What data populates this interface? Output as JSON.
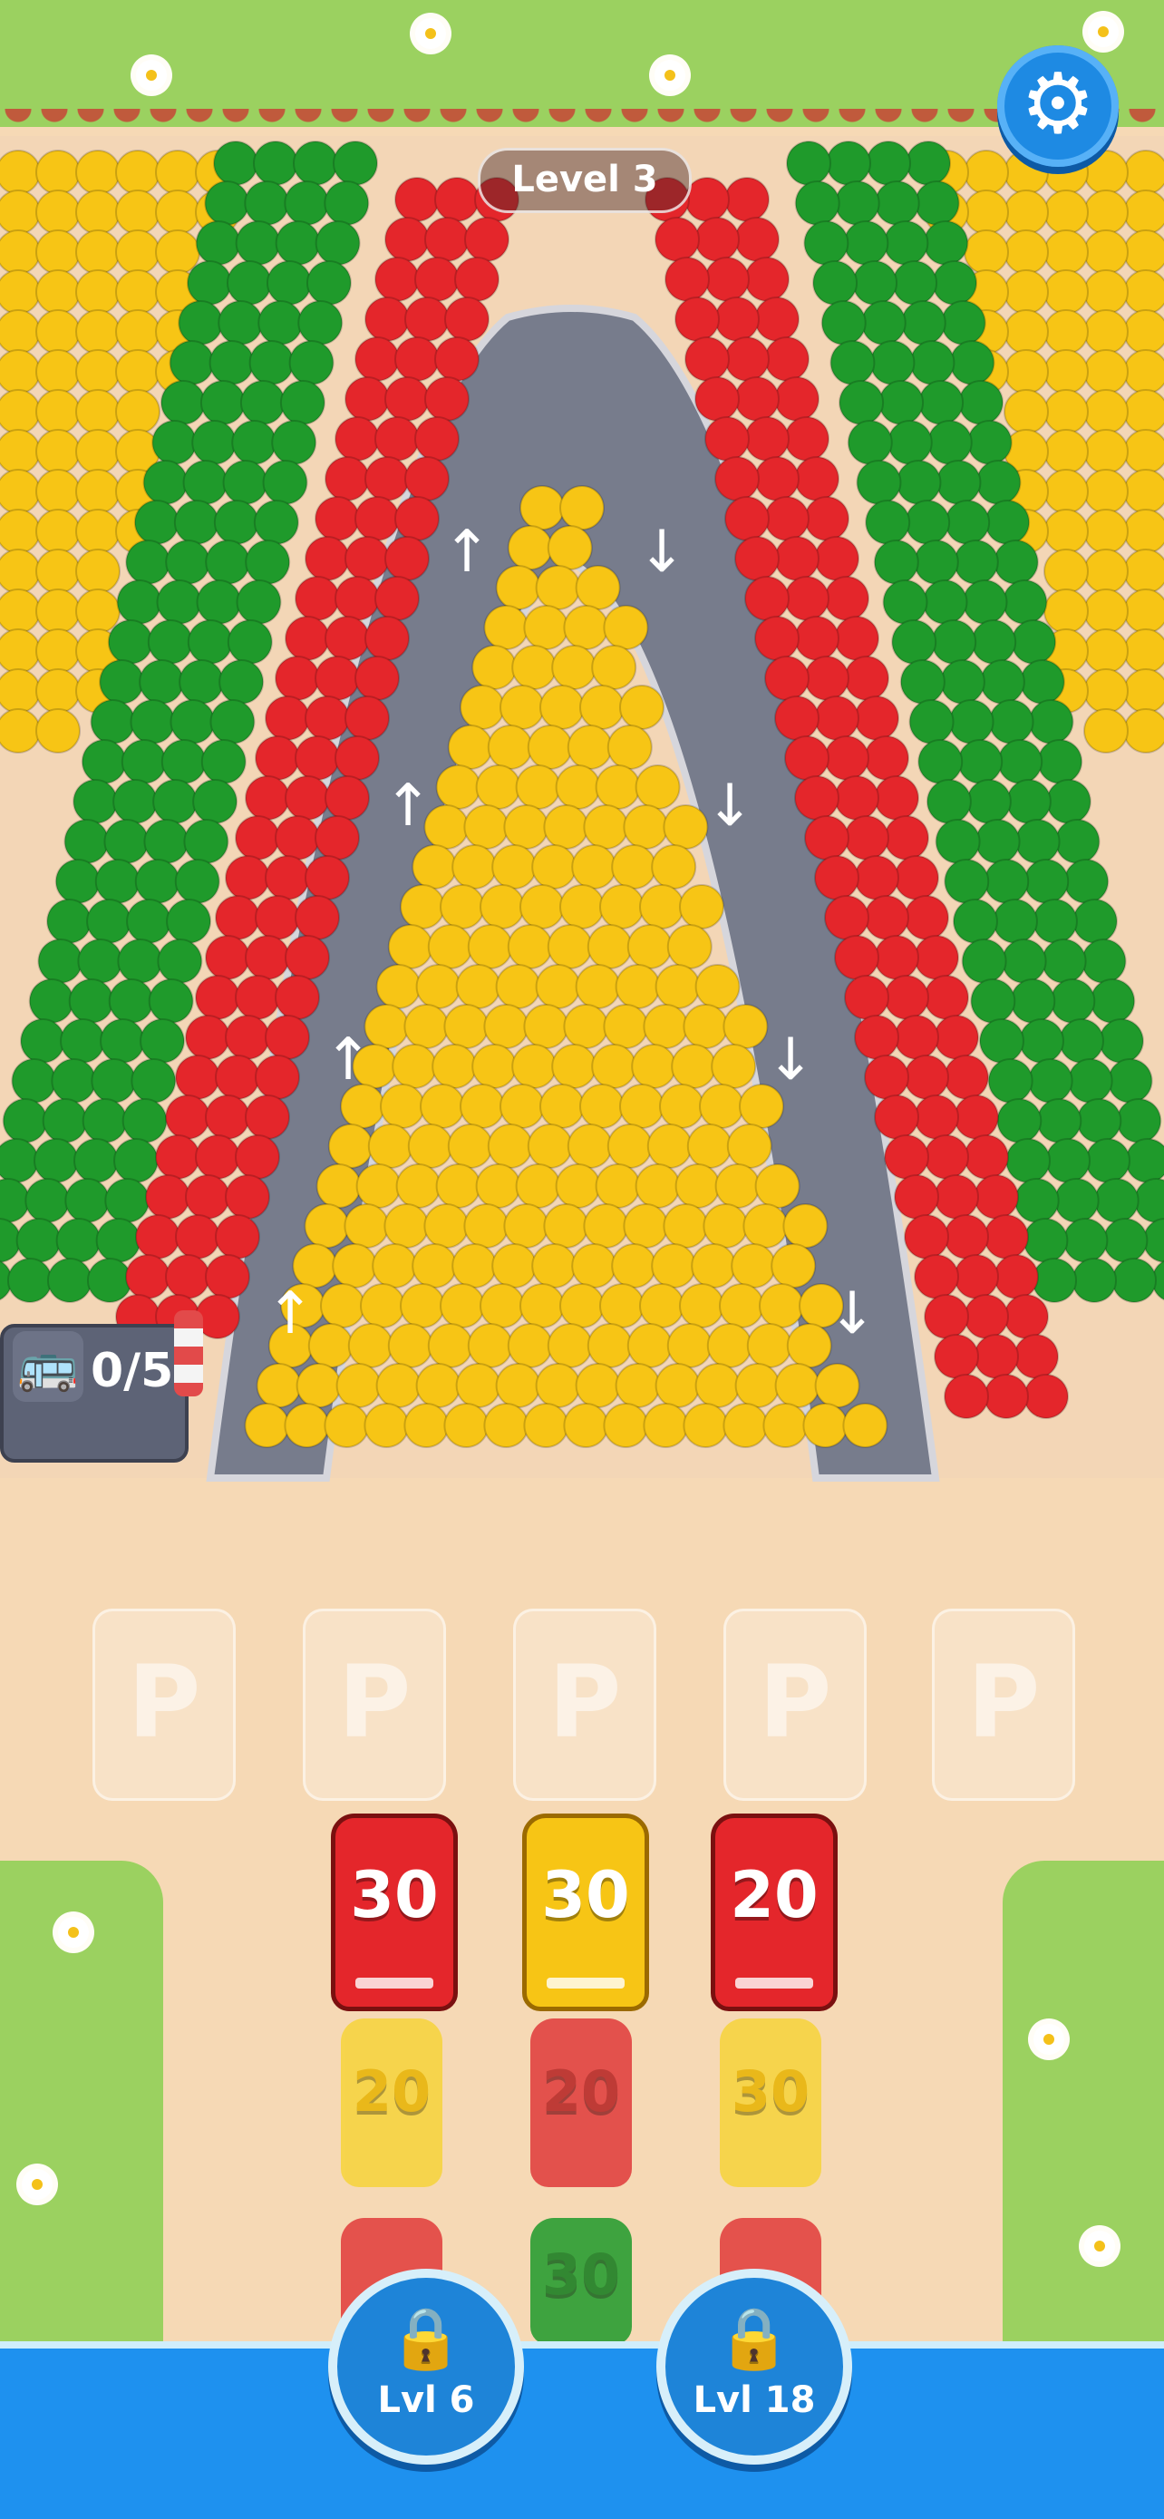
{
  "hud": {
    "level_label": "Level 3",
    "settings_icon": "gear-icon",
    "garage": {
      "icon": "bus-icon",
      "count": "0/5"
    }
  },
  "colors": {
    "red": "#e4262b",
    "yellow": "#f7c515",
    "green": "#1f9a2b",
    "road": "#777c8c",
    "sand": "#f6d9b5",
    "water": "#1e91ef",
    "accent_blue": "#1e8ae3"
  },
  "parking_slots": [
    {
      "label": "P"
    },
    {
      "label": "P"
    },
    {
      "label": "P"
    },
    {
      "label": "P"
    },
    {
      "label": "P"
    }
  ],
  "cars": {
    "front_row": [
      {
        "value": "30",
        "color": "red"
      },
      {
        "value": "30",
        "color": "yellow"
      },
      {
        "value": "20",
        "color": "red"
      }
    ],
    "second_row": [
      {
        "value": "20",
        "color": "yellow"
      },
      {
        "value": "20",
        "color": "red"
      },
      {
        "value": "30",
        "color": "yellow"
      }
    ],
    "third_row": [
      {
        "value": "",
        "color": "red"
      },
      {
        "value": "30",
        "color": "green"
      },
      {
        "value": "",
        "color": "red"
      }
    ]
  },
  "locked_buttons": [
    {
      "label": "Lvl 6",
      "icon": "lock-icon"
    },
    {
      "label": "Lvl 18",
      "icon": "lock-icon"
    }
  ],
  "road_arrows": {
    "left_lane": "up",
    "right_lane": "down"
  }
}
